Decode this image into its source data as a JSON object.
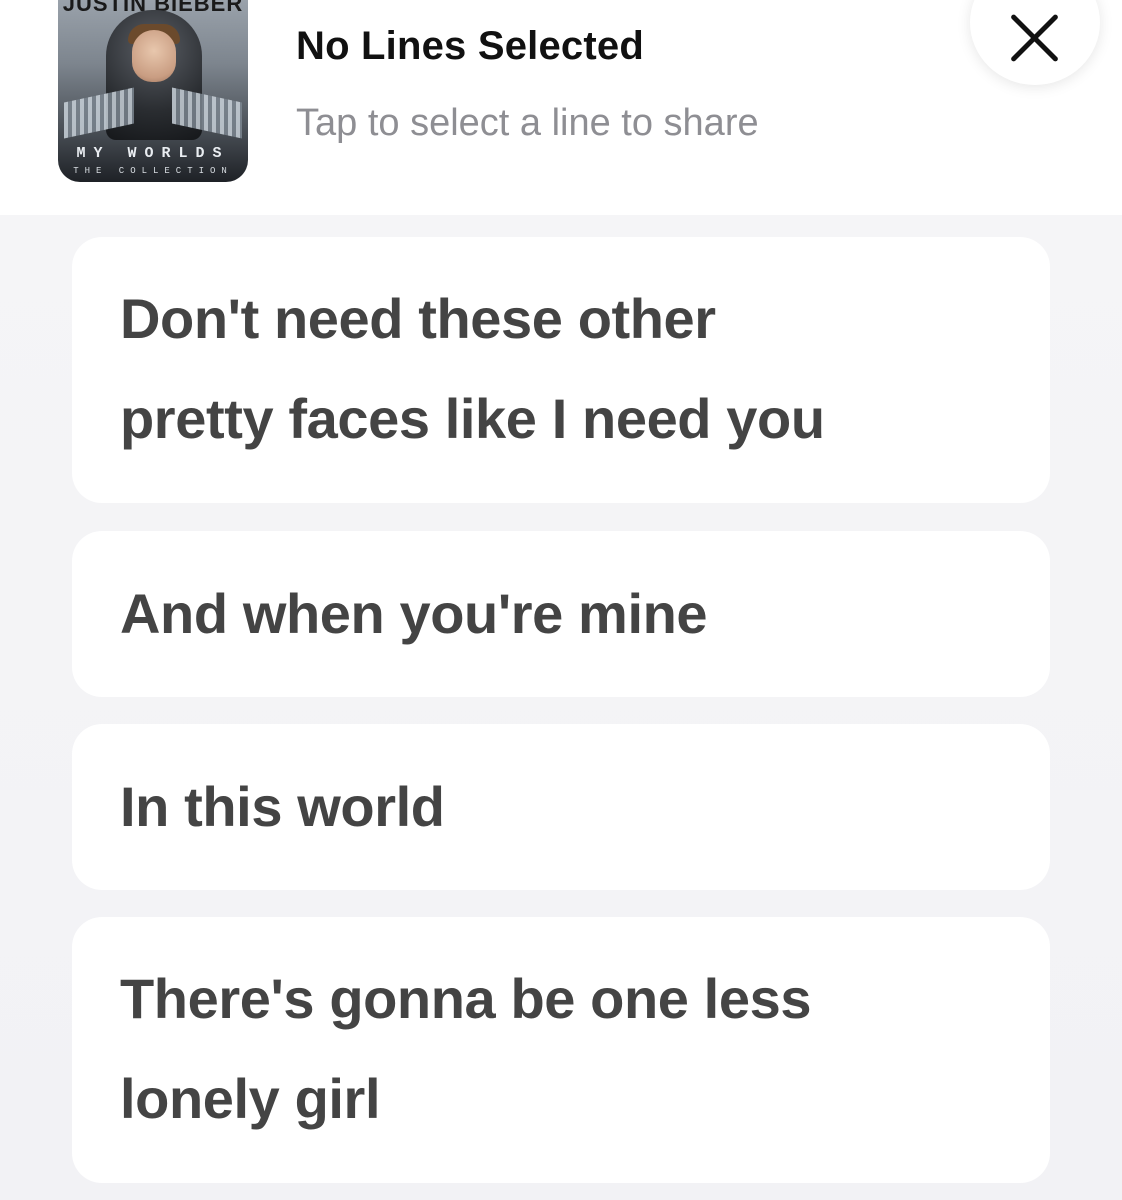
{
  "header": {
    "album_art": {
      "artist_text": "JUSTIN BIEBER",
      "title_text": "MY WORLDS",
      "subtitle_text": "THE COLLECTION"
    },
    "title": "No Lines Selected",
    "subtitle": "Tap to select a line to share",
    "close_icon": "close-icon"
  },
  "lyrics": [
    {
      "line1": "Don't need these other",
      "line2": "pretty faces like I need you"
    },
    {
      "line1": "And when you're mine"
    },
    {
      "line1": "In this world"
    },
    {
      "line1": "There's gonna be one less",
      "line2": "lonely girl"
    }
  ]
}
